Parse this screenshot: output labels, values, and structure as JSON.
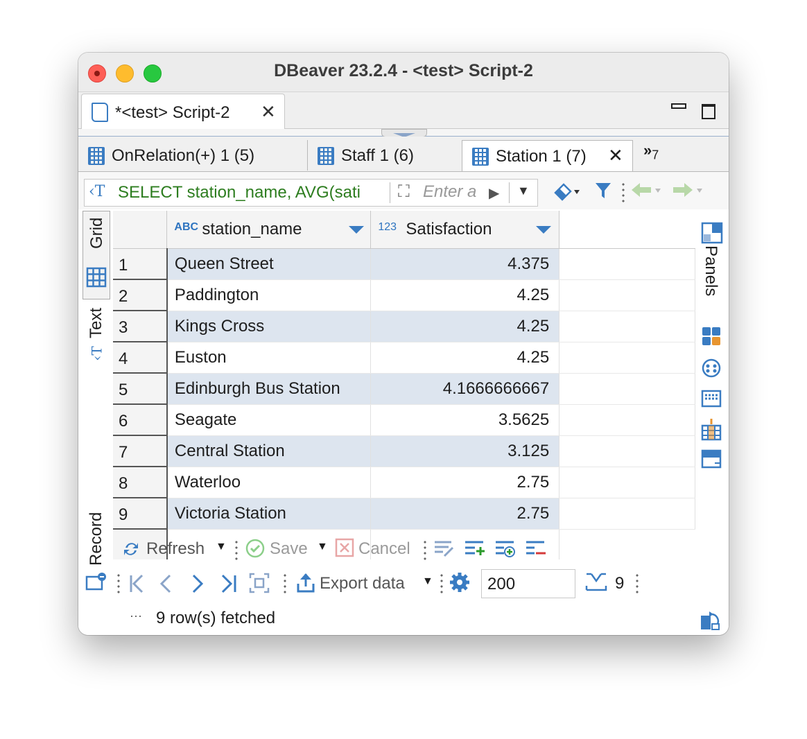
{
  "window": {
    "title": "DBeaver 23.2.4 - <test> Script-2"
  },
  "editor_tab": {
    "label": "*<test> Script-2"
  },
  "result_tabs": [
    {
      "label": "OnRelation(+) 1 (5)"
    },
    {
      "label": "Staff 1 (6)"
    },
    {
      "label": "Station 1 (7)"
    }
  ],
  "more_tabs": {
    "count": "7"
  },
  "filter": {
    "sql": "SELECT station_name, AVG(sati",
    "placeholder": "Enter a"
  },
  "view_tabs": {
    "grid": "Grid",
    "text": "Text",
    "record": "Record"
  },
  "right_panel": {
    "panels": "Panels"
  },
  "table": {
    "columns": [
      {
        "type_icon": "ABC",
        "name": "station_name"
      },
      {
        "type_icon": "123",
        "name": "Satisfaction"
      }
    ],
    "rows": [
      {
        "num": "1",
        "station_name": "Queen Street",
        "satisfaction": "4.375"
      },
      {
        "num": "2",
        "station_name": "Paddington",
        "satisfaction": "4.25"
      },
      {
        "num": "3",
        "station_name": "Kings Cross",
        "satisfaction": "4.25"
      },
      {
        "num": "4",
        "station_name": "Euston",
        "satisfaction": "4.25"
      },
      {
        "num": "5",
        "station_name": "Edinburgh Bus Station",
        "satisfaction": "4.1666666667"
      },
      {
        "num": "6",
        "station_name": "Seagate",
        "satisfaction": "3.5625"
      },
      {
        "num": "7",
        "station_name": "Central Station",
        "satisfaction": "3.125"
      },
      {
        "num": "8",
        "station_name": "Waterloo",
        "satisfaction": "2.75"
      },
      {
        "num": "9",
        "station_name": "Victoria Station",
        "satisfaction": "2.75"
      }
    ]
  },
  "toolbar": {
    "refresh": "Refresh",
    "save": "Save",
    "cancel": "Cancel",
    "export": "Export data",
    "fetch_size": "200",
    "row_count": "9"
  },
  "status": {
    "ellipsis": "···",
    "message": "9 row(s) fetched"
  }
}
